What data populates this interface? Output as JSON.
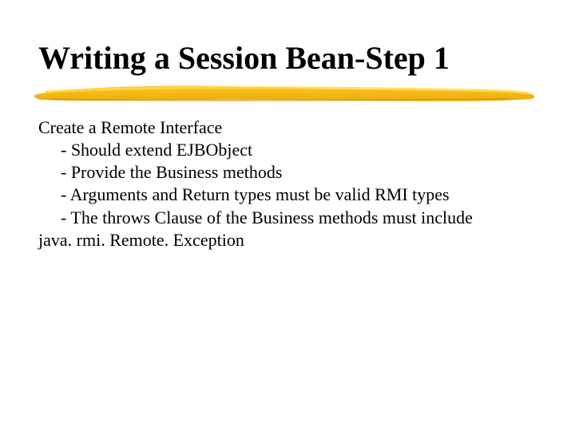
{
  "title": "Writing a Session Bean-Step 1",
  "body": {
    "lead": "Create a Remote Interface",
    "items": [
      "- Should extend EJBObject",
      "- Provide the Business methods",
      "- Arguments and Return types must be valid RMI types",
      "- The throws Clause of the Business methods must include"
    ],
    "trail": "java. rmi. Remote. Exception"
  }
}
